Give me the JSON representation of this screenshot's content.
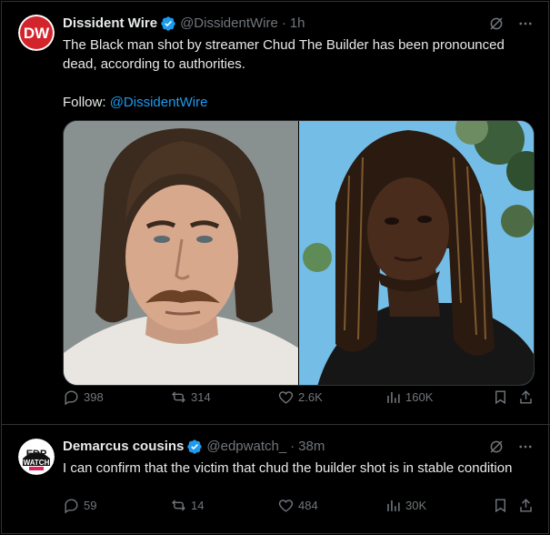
{
  "tweets": [
    {
      "avatar_text": "DW",
      "name": "Dissident Wire",
      "handle": "@DissidentWire",
      "time": "1h",
      "text_line1": "The Black man shot by streamer Chud The Builder has been pronounced dead, according to authorities.",
      "follow_prefix": "Follow: ",
      "follow_link": "@DissidentWire",
      "stats": {
        "replies": "398",
        "reposts": "314",
        "likes": "2.6K",
        "views": "160K"
      }
    },
    {
      "avatar_text_top": "EDP",
      "avatar_text_bottom": "WATCH",
      "name": "Demarcus cousins",
      "handle": "@edpwatch_",
      "time": "38m",
      "text": "I can confirm that the victim that chud the builder shot is in stable condition",
      "stats": {
        "replies": "59",
        "reposts": "14",
        "likes": "484",
        "views": "30K"
      }
    }
  ],
  "separator": "·",
  "colors": {
    "background": "#000000",
    "text": "#e7e9ea",
    "muted": "#71767b",
    "link": "#1d9bf0",
    "verified": "#1d9bf0",
    "dw_red": "#d3242b"
  }
}
